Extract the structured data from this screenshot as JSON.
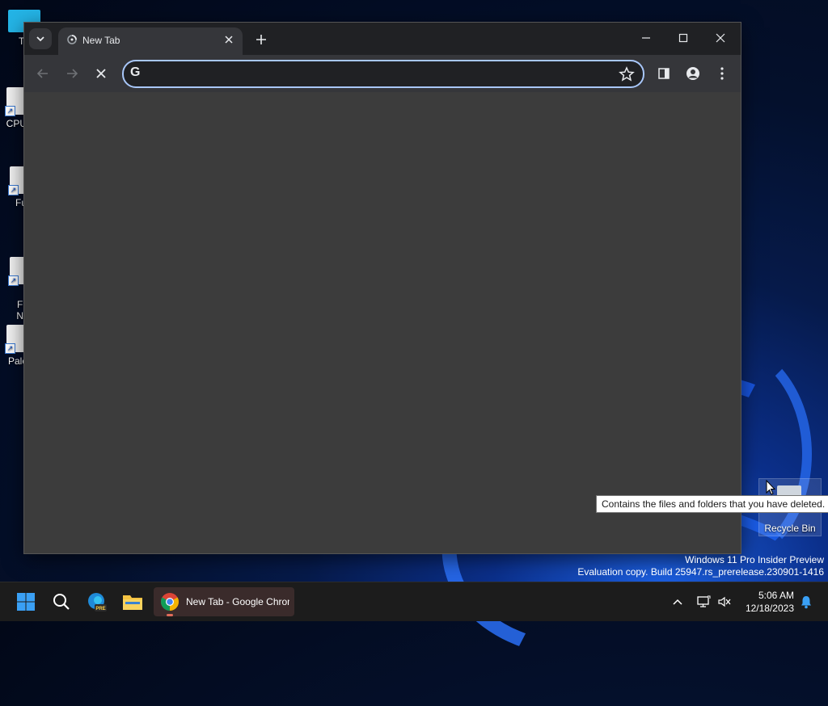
{
  "desktop": {
    "icons": [
      {
        "label": "Th"
      },
      {
        "label": "CPUI"
      },
      {
        "label": "Fu"
      },
      {
        "label": "Fi\nNi"
      },
      {
        "label": "Pale"
      }
    ],
    "recycle_bin_label": "Recycle Bin",
    "tooltip": "Contains the files and folders that you have deleted.",
    "watermark": {
      "line1": "Windows 11 Pro Insider Preview",
      "line2": "Evaluation copy. Build 25947.rs_prerelease.230901-1416"
    }
  },
  "browser": {
    "tab": {
      "title": "New Tab"
    },
    "omnibox": {
      "value": "",
      "placeholder": ""
    },
    "colors": {
      "frame": "#202124",
      "toolbar": "#35363a",
      "content": "#3c3c3c",
      "focus_ring": "#a8c7fa"
    },
    "icons": {
      "tab_search": "chevron-down-icon",
      "favicon": "loading-spinner-icon",
      "tab_close": "close-icon",
      "new_tab": "plus-icon",
      "minimize": "minimize-icon",
      "maximize": "maximize-icon",
      "close": "close-icon",
      "back": "arrow-left-icon",
      "forward": "arrow-right-icon",
      "stop": "stop-x-icon",
      "google": "google-g-icon",
      "bookmark": "star-icon",
      "side_panel": "side-panel-icon",
      "profile": "person-icon",
      "menu": "kebab-menu-icon"
    }
  },
  "taskbar": {
    "chrome_label": "New Tab - Google Chrome",
    "time": "5:06 AM",
    "date": "12/18/2023",
    "icons": {
      "start": "windows-start-icon",
      "search": "search-icon",
      "edge": "edge-beta-icon",
      "explorer": "file-explorer-icon",
      "chrome": "chrome-icon",
      "tray_chevron": "chevron-up-icon",
      "network": "network-icon",
      "volume": "volume-muted-icon",
      "notifications": "bell-icon"
    }
  }
}
